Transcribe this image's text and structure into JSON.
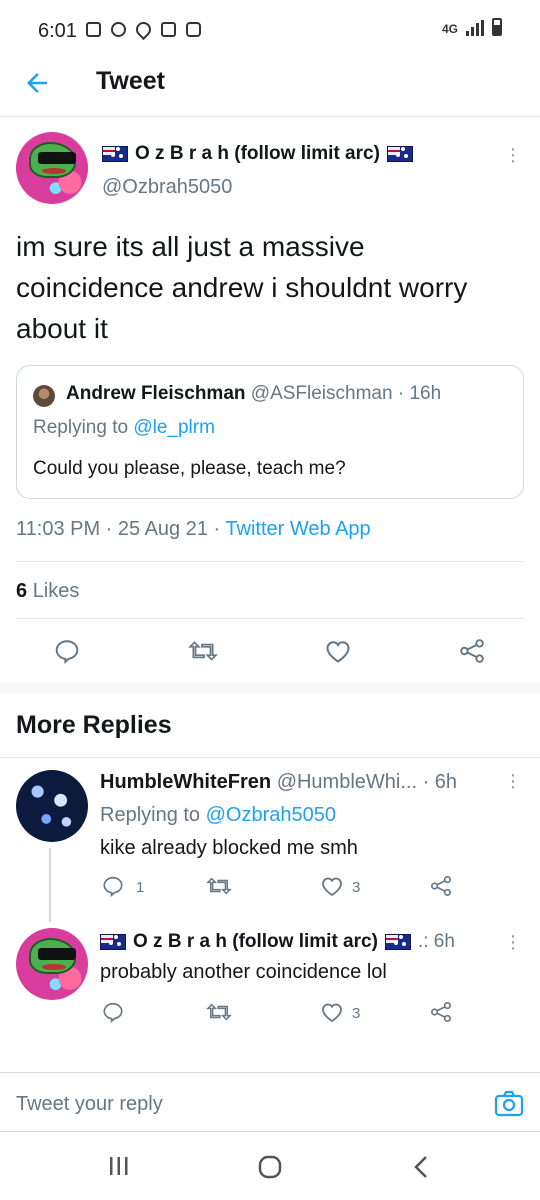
{
  "status_bar": {
    "time": "6:01",
    "network": "4G"
  },
  "app_bar": {
    "title": "Tweet"
  },
  "tweet": {
    "author": "O z B r a h (follow limit arc)",
    "handle": "@Ozbrah5050",
    "text": "im sure its all just a massive coincidence andrew i shouldnt worry about it",
    "quote": {
      "author": "Andrew Fleischman",
      "handle_time": "@ASFleischman · 16h",
      "replying_prefix": "Replying to",
      "replying_to": "@le_plrm",
      "text": "Could you please, please, teach me?"
    },
    "time": "11:03 PM · 25 Aug 21 ·",
    "source": "Twitter Web App",
    "likes_count": "6",
    "likes_label": "Likes"
  },
  "more_replies": {
    "title": "More Replies",
    "replies": [
      {
        "author": "HumbleWhiteFren",
        "handle_time": "@HumbleWhi... · 6h",
        "replying_prefix": "Replying to",
        "replying_to": "@Ozbrah5050",
        "text": "kike already blocked me smh",
        "reply_count": "1",
        "retweet_count": "",
        "like_count": "3"
      },
      {
        "author": "O z B r a h (follow limit arc)",
        "handle_time": ".: 6h",
        "text": "probably another coincidence lol",
        "reply_count": "",
        "retweet_count": "",
        "like_count": "3"
      }
    ]
  },
  "compose": {
    "placeholder": "Tweet your reply"
  },
  "colors": {
    "accent": "#1da1f2",
    "text": "#14171a",
    "secondary": "#657786",
    "border": "#e1e8ed"
  },
  "icons": [
    "back-arrow-icon",
    "more-icon",
    "reply-icon",
    "retweet-icon",
    "like-icon",
    "share-icon",
    "camera-icon",
    "recents-icon",
    "home-icon",
    "back-icon"
  ]
}
